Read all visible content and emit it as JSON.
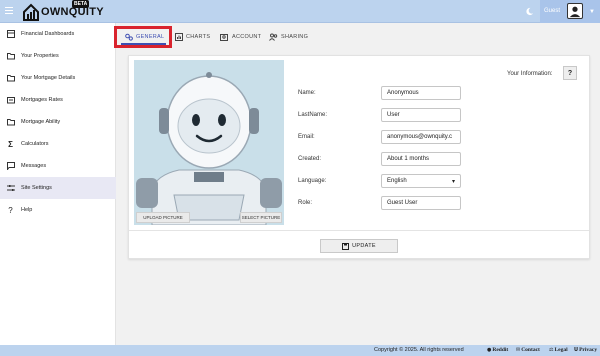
{
  "app": {
    "brand": "OWNQUITY",
    "badge": "BETA",
    "user_name": "Guest"
  },
  "sidebar": {
    "items": [
      {
        "label": "Financial Dashboards",
        "icon": "dashboard-icon"
      },
      {
        "label": "Your Properties",
        "icon": "folder-icon"
      },
      {
        "label": "Your Mortgage Details",
        "icon": "folder-icon"
      },
      {
        "label": "Mortgages Rates",
        "icon": "rates-icon"
      },
      {
        "label": "Mortgage Ability",
        "icon": "folder-icon"
      },
      {
        "label": "Calculators",
        "icon": "sigma-icon"
      },
      {
        "label": "Messages",
        "icon": "message-icon"
      },
      {
        "label": "Site Settings",
        "icon": "sliders-icon",
        "active": true
      },
      {
        "label": "Help",
        "icon": "question-icon"
      }
    ]
  },
  "tabs": [
    {
      "label": "GENERAL",
      "active": true
    },
    {
      "label": "CHARTS"
    },
    {
      "label": "ACCOUNT"
    },
    {
      "label": "SHARING"
    }
  ],
  "profile": {
    "upload_label": "UPLOAD PICTURE",
    "select_label": "SELECT PICTURE",
    "info_title": "Your Information:",
    "help_label": "?",
    "fields": {
      "name": {
        "label": "Name:",
        "value": "Anonymous"
      },
      "lastname": {
        "label": "LastName:",
        "value": "User"
      },
      "email": {
        "label": "Email:",
        "value": "anonymous@ownquity.c"
      },
      "created": {
        "label": "Created:",
        "value": "About 1 months"
      },
      "language": {
        "label": "Language:",
        "value": "English"
      },
      "role": {
        "label": "Role:",
        "value": "Guest User"
      }
    },
    "update_label": "UPDATE"
  },
  "footer": {
    "copyright": "Copyright © 2025. All rights reserved",
    "links": [
      "Reddit",
      "Contact",
      "Legal",
      "Privacy"
    ]
  },
  "colors": {
    "topbar": "#bcd3ee",
    "accent": "#3f4fb2",
    "highlight": "#d9232d"
  }
}
